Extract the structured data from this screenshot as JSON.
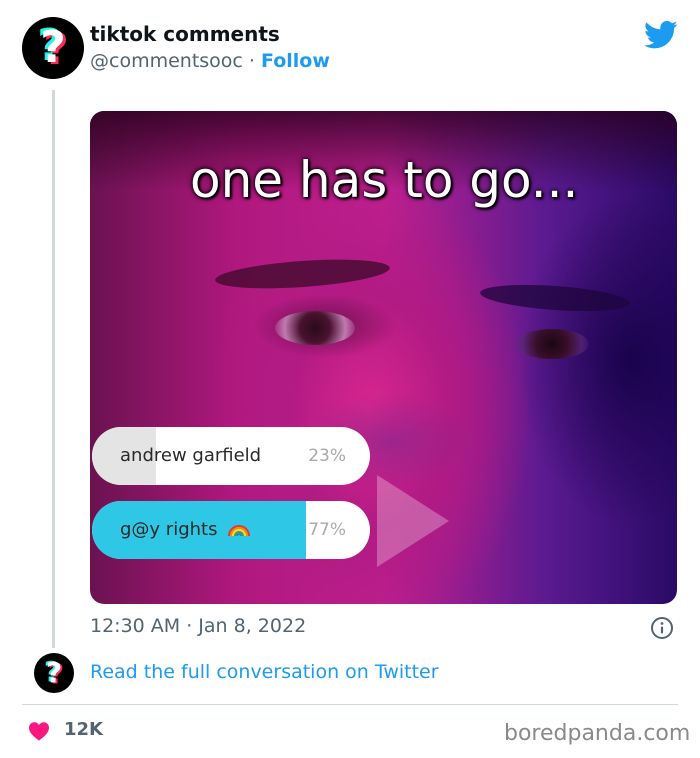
{
  "author": {
    "display_name": "tiktok comments",
    "handle": "@commentsooc",
    "separator": "·",
    "follow_label": "Follow",
    "avatar_glyph": "?"
  },
  "media": {
    "overlay_text": "one has to go...",
    "poll": [
      {
        "label": "andrew garfield",
        "percent_label": "23%",
        "percent": 23,
        "emoji": ""
      },
      {
        "label": "g@y rights",
        "percent_label": "77%",
        "percent": 77,
        "emoji": "rainbow"
      }
    ]
  },
  "tweet": {
    "timestamp": "12:30 AM · Jan 8, 2022"
  },
  "footer": {
    "read_more_label": "Read the full conversation on Twitter",
    "like_count": "12K"
  },
  "watermark": "boredpanda.com",
  "icons": {
    "brand": "twitter-bird-icon",
    "info": "info-icon",
    "like": "heart-icon",
    "media": "play-icon"
  },
  "colors": {
    "twitter_blue": "#1d9bf0",
    "heart": "#f91880",
    "poll_fill_winner": "#2ec8e6",
    "poll_fill_loser": "#e4e4e4"
  }
}
